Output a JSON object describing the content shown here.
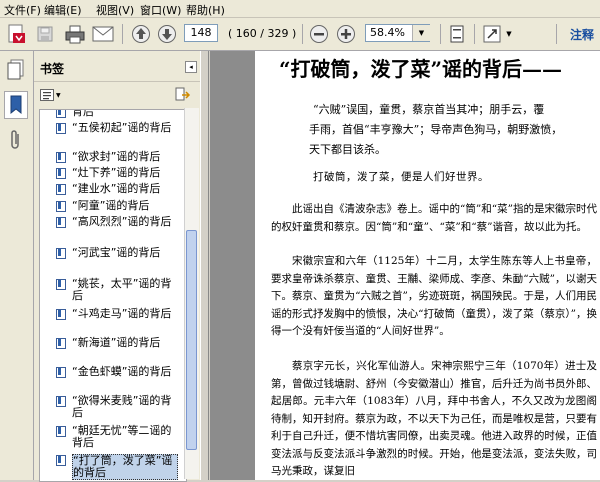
{
  "menu": [
    "文件(F)",
    "编辑(E)",
    "视图(V)",
    "窗口(W)",
    "帮助(H)"
  ],
  "toolbar": {
    "page_number": "148",
    "page_count": "( 160 / 329 )",
    "zoom": "58.4%",
    "annotate_label": "注释"
  },
  "panel": {
    "title": "书签",
    "close_glyph": "◂"
  },
  "bookmarks": [
    {
      "label": "背后"
    },
    {
      "label": "“五侯初起”谣的背后"
    },
    {
      "label": "“欲求封”谣的背后"
    },
    {
      "label": "“灶下养”谣的背后"
    },
    {
      "label": "“建业水”谣的背后"
    },
    {
      "label": "“阿童”谣的背后"
    },
    {
      "label": "“高风烈烈”谣的背后"
    },
    {
      "label": "“河武宝”谣的背后"
    },
    {
      "label": "“姚苌，太平”谣的背后"
    },
    {
      "label": "“斗鸡走马”谣的背后"
    },
    {
      "label": "“新海道”谣的背后"
    },
    {
      "label": "“金色虾蟆”谣的背后"
    },
    {
      "label": "“欲得米麦贱”谣的背后"
    },
    {
      "label": "“朝廷无忧”等二谣的背后"
    },
    {
      "label": "“打了筒，泼了菜”谣的背后"
    }
  ],
  "document": {
    "title": "“打破筒，泼了菜”谣的背后——",
    "verse_lines": [
      "“六贼”误国，童贯，蔡京首当其冲；朋手云，覆",
      "手雨，首倡“丰亨豫大”；导帝声色狗马，朝野激愤，",
      "天下都目该杀。"
    ],
    "rhyme": "打破筒，泼了菜，便是人们好世界。",
    "paragraphs": [
      "此谣出自《清波杂志》卷上。谣中的“筒”和“菜”指的是宋徽宗时代的权奸童贯和蔡京。因“筒”和“童”、“菜”和“蔡”谐音，故以此为托。",
      "宋徽宗宣和六年（1125年）十二月，太学生陈东等人上书皇帝，要求皇帝诛杀蔡京、童贯、王黼、梁师成、李彦、朱勔“六贼”，以谢天下。蔡京、童贯为“六贼之首”，劣迹斑斑，祸国殃民。于是，人们用民谣的形式抒发胸中的愤恨，决心“打破筒（童贯），泼了菜（蔡京）”，换得一个没有奸佞当道的“人间好世界”。",
      "蔡京字元长，兴化军仙游人。宋神宗熙宁三年（1070年）进士及第，曾做过钱塘尉、舒州（今安徽潜山）推官，后升迁为尚书员外郎、起居郎。元丰六年（1083年）八月，拜中书舍人，不久又改为龙图阁待制，知开封府。蔡京为政，不以天下为己任，而是唯权是营，只要有利于自己升迁，便不惜坑害同僚，出卖灵魂。他进入政界的时候，正值变法派与反变法派斗争激烈的时候。开始，他是变法派，变法失败，司马光秉政，谋复旧"
    ]
  }
}
